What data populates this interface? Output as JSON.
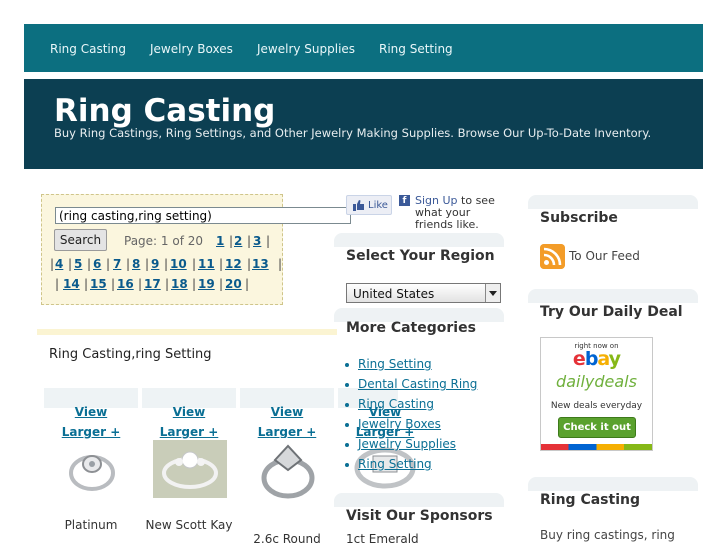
{
  "nav": {
    "items": [
      "Ring Casting",
      "Jewelry Boxes",
      "Jewelry Supplies",
      "Ring Setting"
    ]
  },
  "header": {
    "title": "Ring Casting",
    "tagline": "Buy Ring Castings, Ring Settings, and Other Jewelry Making Supplies. Browse Our Up-To-Date Inventory."
  },
  "search": {
    "query": "(ring casting,ring setting)",
    "button": "Search",
    "page_info": "Page: 1 of 20"
  },
  "pagination": [
    "1",
    "2",
    "3",
    "4",
    "5",
    "6",
    "7",
    "8",
    "9",
    "10",
    "11",
    "12",
    "13",
    "14",
    "15",
    "16",
    "17",
    "18",
    "19",
    "20"
  ],
  "results": {
    "title": "Ring Casting,ring Setting",
    "view_label": "View",
    "larger_label": "Larger +",
    "products": [
      {
        "name": "Platinum"
      },
      {
        "name": "New Scott Kay"
      },
      {
        "name": "2.6c Round"
      },
      {
        "name": ""
      }
    ]
  },
  "facebook": {
    "like_label": "Like",
    "signup": "Sign Up",
    "text": " to see what your friends like."
  },
  "region": {
    "title": "Select Your Region",
    "selected": "United States"
  },
  "categories": {
    "title": "More Categories",
    "items": [
      "Ring Setting",
      "Dental Casting Ring",
      "Ring Casting",
      "Jewelry Boxes",
      "Jewelry Supplies",
      "Ring Setting"
    ]
  },
  "sponsors": {
    "title": "Visit Our Sponsors",
    "first": "1ct Emerald"
  },
  "subscribe": {
    "title": "Subscribe",
    "feed_label": "To Our Feed"
  },
  "daily_deal": {
    "title": "Try Our Daily Deal",
    "ad_top": "right now on",
    "ad_brand": "ebay",
    "ad_daily": "dailydeals",
    "ad_sub": "New deals everyday",
    "ad_button": "Check it out"
  },
  "side_ring": {
    "title": "Ring Casting",
    "text": "Buy ring castings, ring"
  },
  "colors": {
    "nav_bg": "#0c6f80",
    "header_bg": "#0c3f52",
    "link": "#0a6f94",
    "search_bg": "#fbf6de"
  }
}
